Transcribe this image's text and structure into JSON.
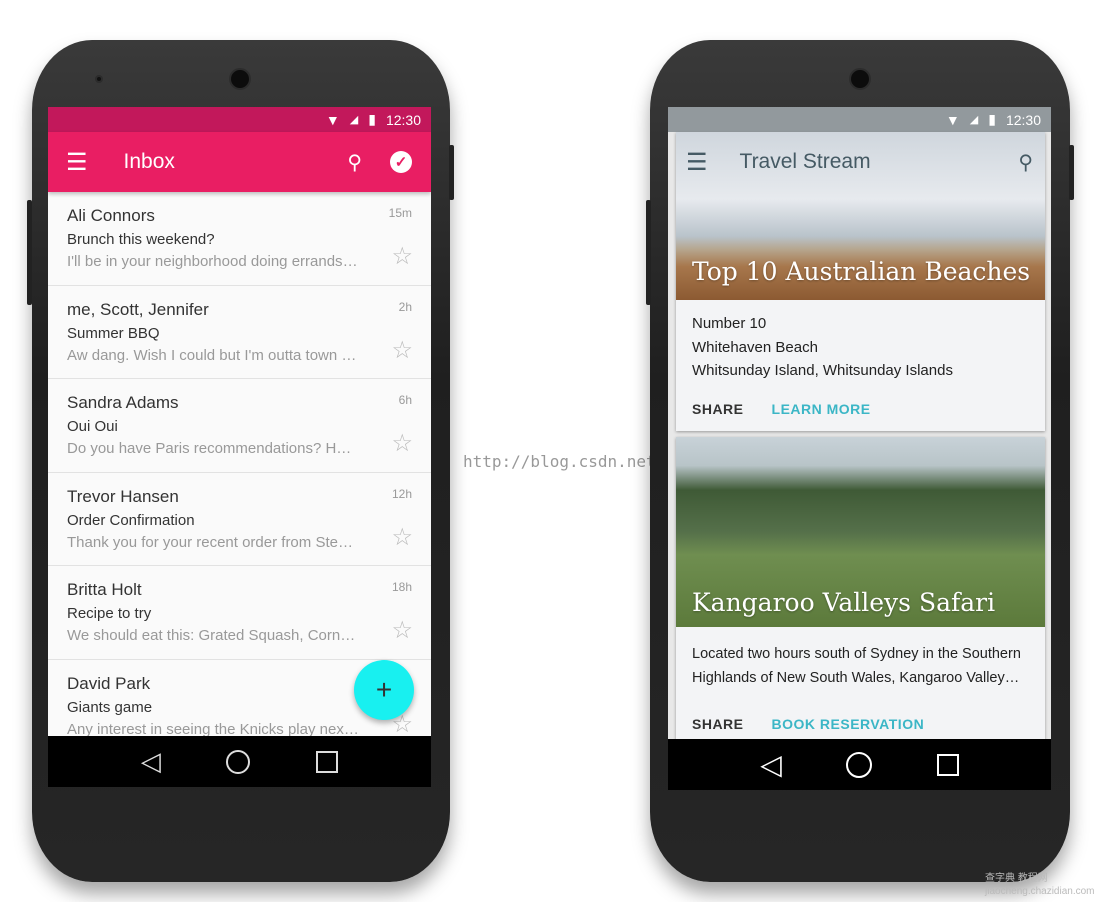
{
  "watermark_url": "http://blog.csdn.net/",
  "watermark_logo": "查字典 教程网 jiaocheng.chazidian.com",
  "colors": {
    "inbox_accent": "#e91e63",
    "fab": "#18f0f0",
    "link": "#3bb6c6"
  },
  "left_phone": {
    "status": {
      "time": "12:30",
      "icons": [
        "wifi-icon",
        "signal-icon",
        "battery-icon"
      ]
    },
    "toolbar": {
      "title": "Inbox",
      "icons": [
        "menu-icon",
        "search-icon",
        "check-circle-icon"
      ]
    },
    "emails": [
      {
        "from": "Ali Connors",
        "subject": "Brunch this weekend?",
        "preview": "I'll be in your neighborhood doing errands …",
        "time": "15m"
      },
      {
        "from": "me, Scott, Jennifer",
        "subject": "Summer BBQ",
        "preview": "Aw dang. Wish I could but I'm outta town …",
        "time": "2h"
      },
      {
        "from": "Sandra Adams",
        "subject": "Oui Oui",
        "preview": "Do you have Paris recommendations? Have you ever…",
        "time": "6h"
      },
      {
        "from": "Trevor Hansen",
        "subject": "Order Confirmation",
        "preview": "Thank you for your recent order from Stevens…",
        "time": "12h"
      },
      {
        "from": "Britta Holt",
        "subject": "Recipe to try",
        "preview": "We should eat this: Grated Squash, Corn, …",
        "time": "18h"
      },
      {
        "from": "David Park",
        "subject": "Giants game",
        "preview": "Any interest in seeing the Knicks play next week?",
        "time": ""
      }
    ],
    "fab_label": "+"
  },
  "right_phone": {
    "status": {
      "time": "12:30"
    },
    "toolbar": {
      "title": "Travel Stream",
      "icons": [
        "menu-icon",
        "search-icon"
      ]
    },
    "cards": [
      {
        "title": "Top 10 Australian Beaches",
        "lines": [
          "Number 10",
          "Whitehaven Beach",
          "Whitsunday Island, Whitsunday Islands"
        ],
        "actions": [
          "SHARE",
          "LEARN MORE"
        ]
      },
      {
        "title": "Kangaroo Valleys Safari",
        "lines": [
          "Located two hours south of Sydney in the Southern",
          "Highlands of New South Wales, Kangaroo Valley…"
        ],
        "actions": [
          "SHARE",
          "BOOK RESERVATION"
        ]
      }
    ]
  }
}
